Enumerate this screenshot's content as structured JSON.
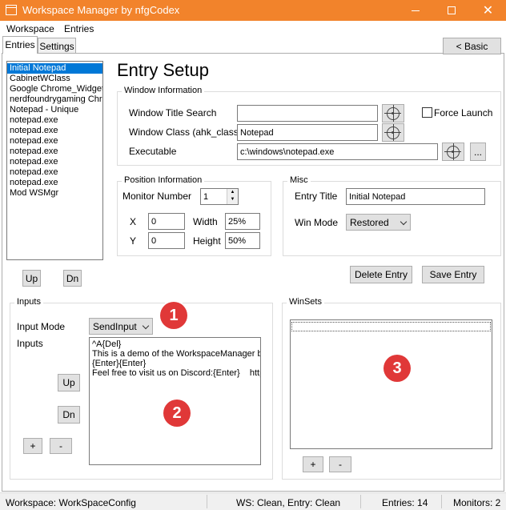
{
  "window": {
    "title": "Workspace Manager by nfgCodex",
    "min_label": "",
    "close_label": "✕"
  },
  "menu": [
    {
      "label": "Workspace"
    },
    {
      "label": "Entries"
    }
  ],
  "tabs": [
    {
      "label": "Entries"
    },
    {
      "label": "Settings"
    }
  ],
  "basic_button": "< Basic",
  "entries_list": [
    "Initial Notepad",
    "CabinetWClass",
    "Google Chrome_Widget'",
    "nerdfoundrygaming Chro",
    "Notepad - Unique",
    "notepad.exe",
    "notepad.exe",
    "notepad.exe",
    "notepad.exe",
    "notepad.exe",
    "notepad.exe",
    "notepad.exe",
    "Mod WSMgr"
  ],
  "list_buttons": {
    "up": "Up",
    "down": "Dn"
  },
  "entry_setup": {
    "heading": "Entry Setup",
    "window_info": {
      "group_label": "Window Information",
      "title_search_label": "Window Title Search",
      "title_search_value": "",
      "class_label": "Window Class (ahk_class)",
      "class_value": "Notepad",
      "exe_label": "Executable",
      "exe_value": "c:\\windows\\notepad.exe",
      "browse_label": "...",
      "force_launch_label": "Force Launch"
    },
    "position_info": {
      "group_label": "Position Information",
      "monitor_label": "Monitor Number",
      "monitor_value": "1",
      "x_label": "X",
      "x_value": "0",
      "y_label": "Y",
      "y_value": "0",
      "width_label": "Width",
      "width_value": "25%",
      "height_label": "Height",
      "height_value": "50%"
    },
    "misc": {
      "group_label": "Misc",
      "entry_title_label": "Entry Title",
      "entry_title_value": "Initial Notepad",
      "win_mode_label": "Win Mode",
      "win_mode_value": "Restored"
    },
    "delete_button": "Delete Entry",
    "save_button": "Save Entry"
  },
  "inputs": {
    "group_label": "Inputs",
    "mode_label": "Input Mode",
    "mode_value": "SendInput",
    "inputs_label": "Inputs",
    "text": "^A{Del}\nThis is a demo of the WorkspaceManager by\n{Enter}{Enter}\nFeel free to visit us on Discord:{Enter}    http",
    "up_label": "Up",
    "down_label": "Dn",
    "add_label": "+",
    "remove_label": "-"
  },
  "winsets": {
    "group_label": "WinSets",
    "add_label": "+",
    "remove_label": "-"
  },
  "badges": [
    "1",
    "2",
    "3"
  ],
  "status": {
    "workspace": "Workspace: WorkSpaceConfig",
    "state": "WS: Clean, Entry: Clean",
    "entries": "Entries: 14",
    "monitors": "Monitors: 2"
  },
  "colors": {
    "titlebar": "#f2832b",
    "selection": "#0078d7",
    "badge": "#e03838"
  }
}
